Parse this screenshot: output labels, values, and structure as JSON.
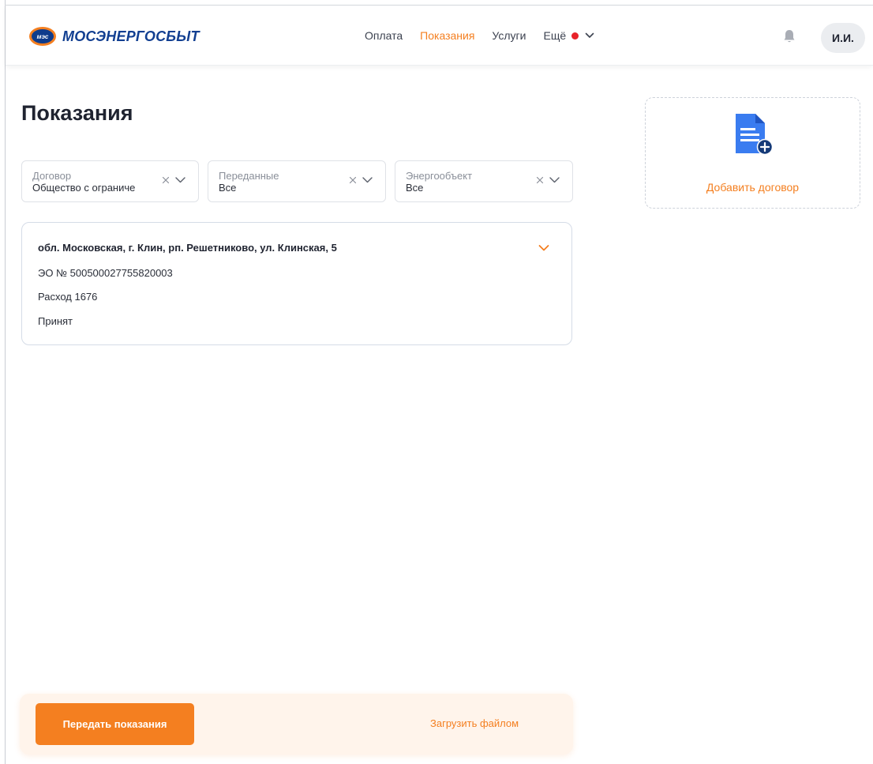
{
  "brand": {
    "badge": "мэс",
    "name": "МОСЭНЕРГОСБЫТ"
  },
  "nav": {
    "items": [
      {
        "label": "Оплата",
        "active": false
      },
      {
        "label": "Показания",
        "active": true
      },
      {
        "label": "Услуги",
        "active": false
      }
    ],
    "more_label": "Ещё"
  },
  "user": {
    "initials": "И.И."
  },
  "page": {
    "title": "Показания"
  },
  "filters": {
    "contract": {
      "label": "Договор",
      "value": "Общество с ограниче"
    },
    "submitted": {
      "label": "Переданные",
      "value": "Все"
    },
    "object": {
      "label": "Энергообъект",
      "value": "Все"
    }
  },
  "record": {
    "address": "обл. Московская, г. Клин, рп. Решетниково, ул. Клинская, 5",
    "eo_number": "ЭО № 500500027755820003",
    "consumption": "Расход 1676",
    "status": "Принят"
  },
  "add_contract": {
    "label": "Добавить договор"
  },
  "actions": {
    "submit_label": "Передать показания",
    "upload_label": "Загрузить файлом"
  },
  "colors": {
    "accent": "#f47f20",
    "brand_blue": "#123f91",
    "notify_dot": "#e8232a"
  }
}
